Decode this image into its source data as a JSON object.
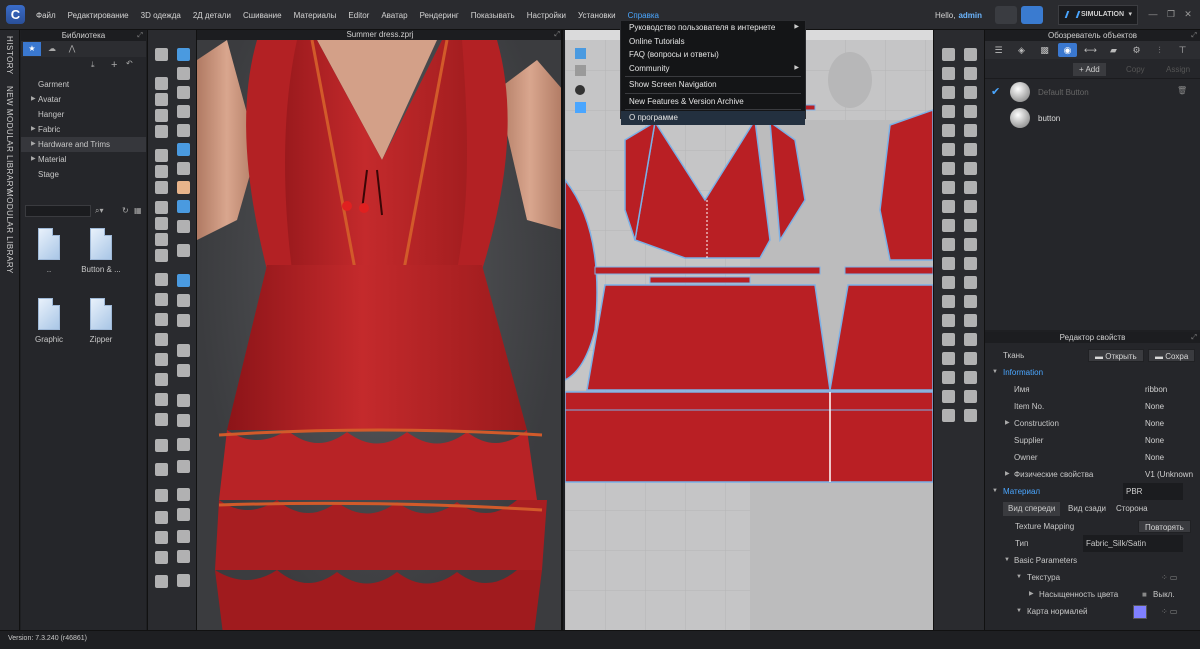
{
  "app": {
    "logo_letter": "C",
    "brand_color": "#3a6cc8",
    "accent_color": "#4aa6ff"
  },
  "menu": {
    "items": [
      "Файл",
      "Редактирование",
      "3D одежда",
      "2Д детали",
      "Сшивание",
      "Материалы",
      "Editor",
      "Аватар",
      "Рендеринг",
      "Показывать",
      "Настройки",
      "Установки",
      "Справка"
    ],
    "active_index": 12
  },
  "user": {
    "greeting": "Hello,",
    "name": "admin"
  },
  "simulation": {
    "label": "SIMULATION"
  },
  "help_menu": {
    "items": [
      {
        "label": "Руководство пользователя в интернете",
        "submenu": true
      },
      {
        "label": "Online Tutorials",
        "submenu": false
      },
      {
        "label": "FAQ (вопросы и ответы)",
        "submenu": false
      },
      {
        "label": "Community",
        "submenu": true
      },
      {
        "label": "Show Screen Navigation",
        "submenu": false
      },
      {
        "label": "New Features & Version Archive",
        "submenu": false
      },
      {
        "label": "О программе",
        "submenu": false
      }
    ],
    "highlighted_index": 6
  },
  "side_tabs": [
    "HISTORY",
    "NEW MODULAR LIBRARY",
    "MODULAR LIBRARY"
  ],
  "library": {
    "title": "Библиотека",
    "tree": [
      {
        "label": "Garment",
        "expandable": false
      },
      {
        "label": "Avatar",
        "expandable": true
      },
      {
        "label": "Hanger",
        "expandable": false
      },
      {
        "label": "Fabric",
        "expandable": true
      },
      {
        "label": "Hardware and Trims",
        "expandable": true,
        "selected": true
      },
      {
        "label": "Material",
        "expandable": true
      },
      {
        "label": "Stage",
        "expandable": false
      }
    ],
    "files": [
      "..",
      "Button & ...",
      "Graphic",
      "Zipper"
    ]
  },
  "viewport3d": {
    "title": "Summer dress.zprj"
  },
  "object_browser": {
    "title": "Обозреватель объектов",
    "add_label": "+ Add",
    "copy_label": "Copy",
    "assign_label": "Assign",
    "objects": [
      {
        "name": "Default Button",
        "checked": true,
        "dim": true
      },
      {
        "name": "button",
        "checked": false,
        "dim": false
      }
    ]
  },
  "property_editor": {
    "title": "Редактор свойств",
    "type_label": "Ткань",
    "open_label": "Открыть",
    "save_label": "Сохра",
    "information_label": "Information",
    "rows": [
      {
        "label": "Имя",
        "value": "ribbon"
      },
      {
        "label": "Item No.",
        "value": "None"
      },
      {
        "label": "Construction",
        "value": "None"
      },
      {
        "label": "Supplier",
        "value": "None"
      },
      {
        "label": "Owner",
        "value": "None"
      },
      {
        "label": "Физические свойства",
        "value": "V1 (Unknown"
      }
    ],
    "material_label": "Материал",
    "material_value": "PBR",
    "material_tabs": [
      "Вид спереди",
      "Вид сзади",
      "Сторона"
    ],
    "texture_mapping_label": "Texture Mapping",
    "texture_mapping_value": "Повторять",
    "type_row_label": "Тип",
    "type_row_value": "Fabric_Silk/Satin",
    "basic_params_label": "Basic Parameters",
    "texture_label": "Текстура",
    "saturation_label": "Насыщенность цвета",
    "saturation_value": "Выкл.",
    "normal_map_label": "Карта нормалей",
    "normal_map_color": "#8080ff"
  },
  "status": {
    "version": "Version: 7.3.240 (r46861)"
  }
}
